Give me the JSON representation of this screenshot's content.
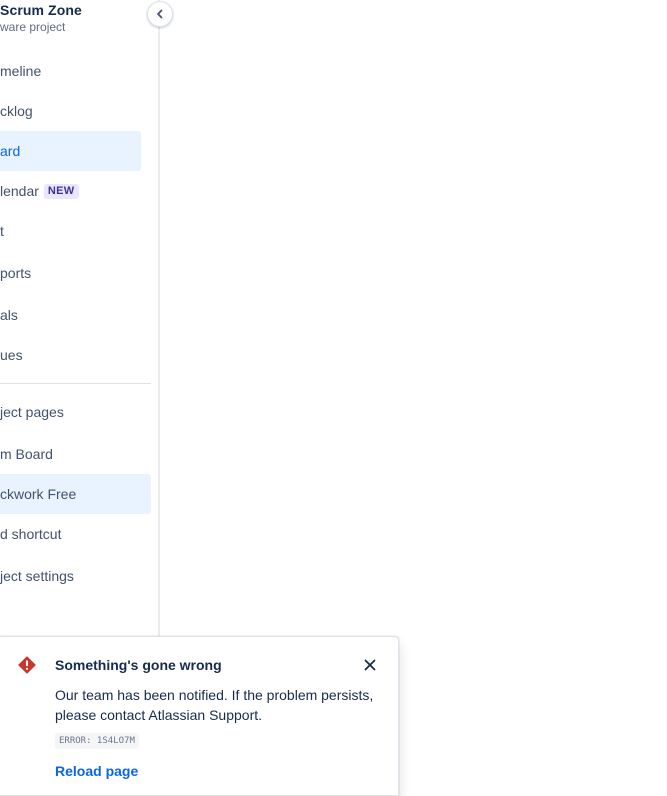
{
  "sidebar": {
    "project_name": "Scrum Zone",
    "project_type": "ware project",
    "nav_items": [
      {
        "label": "meline"
      },
      {
        "label": "cklog"
      },
      {
        "label": "ard"
      },
      {
        "label": "lendar",
        "badge": "NEW"
      },
      {
        "label": "t"
      },
      {
        "label": "ports"
      },
      {
        "label": "als"
      },
      {
        "label": "ues"
      }
    ],
    "section_items": [
      {
        "label": "ject pages"
      },
      {
        "label": "m Board"
      },
      {
        "label": "ckwork Free"
      },
      {
        "label": "d shortcut"
      },
      {
        "label": "ject settings"
      }
    ],
    "collapse_icon": "chevron-left-icon"
  },
  "error_flag": {
    "icon": "error-icon",
    "title": "Something's gone wrong",
    "message": "Our team has been notified. If the problem persists, please contact Atlassian Support.",
    "error_code": "ERROR: 1S4LO7M",
    "action_label": "Reload page",
    "close_icon": "close-icon"
  },
  "colors": {
    "accent": "#0c66e4",
    "selected_bg": "#e9f2ff",
    "error": "#c9372c",
    "badge_bg": "#eae6ff",
    "badge_text": "#403294"
  }
}
